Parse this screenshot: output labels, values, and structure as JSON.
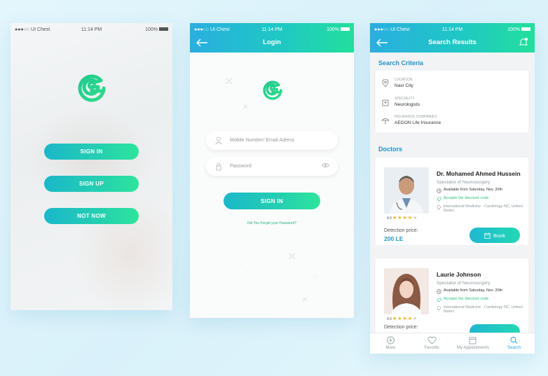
{
  "status": {
    "carrier": "●●●○○ UI Chest",
    "time": "11:14 PM",
    "battery": "100%"
  },
  "welcome": {
    "buttons": [
      "SIGN IN",
      "SIGN UP",
      "NOT NOW"
    ]
  },
  "login": {
    "title": "Login",
    "phone_placeholder": "Mobile Number/ Email Adress",
    "password_placeholder": "Password",
    "signin_label": "SIGN IN",
    "forgot_label": "Did You Forget your Password?"
  },
  "search": {
    "title": "Search Results",
    "criteria_title": "Search Criteria",
    "criteria": [
      {
        "label": "LOCATION",
        "value": "Nasr City",
        "icon": "location-pin-icon"
      },
      {
        "label": "SPECIALITY",
        "value": "Neurologists",
        "icon": "hospital-icon"
      },
      {
        "label": "INSURANCE COMPANIES",
        "value": "AEGON Life Insurance",
        "icon": "insurance-icon"
      }
    ],
    "doctors_title": "Doctors",
    "doctors": [
      {
        "name": "Dr. Mohamed Ahmed Hussein",
        "specialty": "Specialist of Neurosurgery",
        "availability": "Available from Saturday, Nov. 20th",
        "discount": "Accepts the discount code",
        "address": "International Medicine - Cardiology NC, United States",
        "rating": "4.0",
        "price_label": "Detection price:",
        "price": "200 LE",
        "book_label": "Book"
      },
      {
        "name": "Laurie Johnson",
        "specialty": "Specialist of Neurosurgery",
        "availability": "Available from Saturday, Nov. 20th",
        "discount": "Accepts the discount code",
        "address": "International Medicine - Cardiology NC, United States",
        "rating": "4.0",
        "price_label": "Detection price:"
      }
    ],
    "tabs": [
      {
        "label": "More",
        "icon": "plus-circle-icon"
      },
      {
        "label": "Favorits",
        "icon": "heart-icon"
      },
      {
        "label": "My Appointments",
        "icon": "calendar-icon"
      },
      {
        "label": "Search",
        "icon": "search-icon"
      }
    ]
  },
  "colors": {
    "gradient_start": "#1ab8c9",
    "gradient_end": "#2ee59c",
    "accent_blue": "#2294c9",
    "green": "#25c07c"
  }
}
